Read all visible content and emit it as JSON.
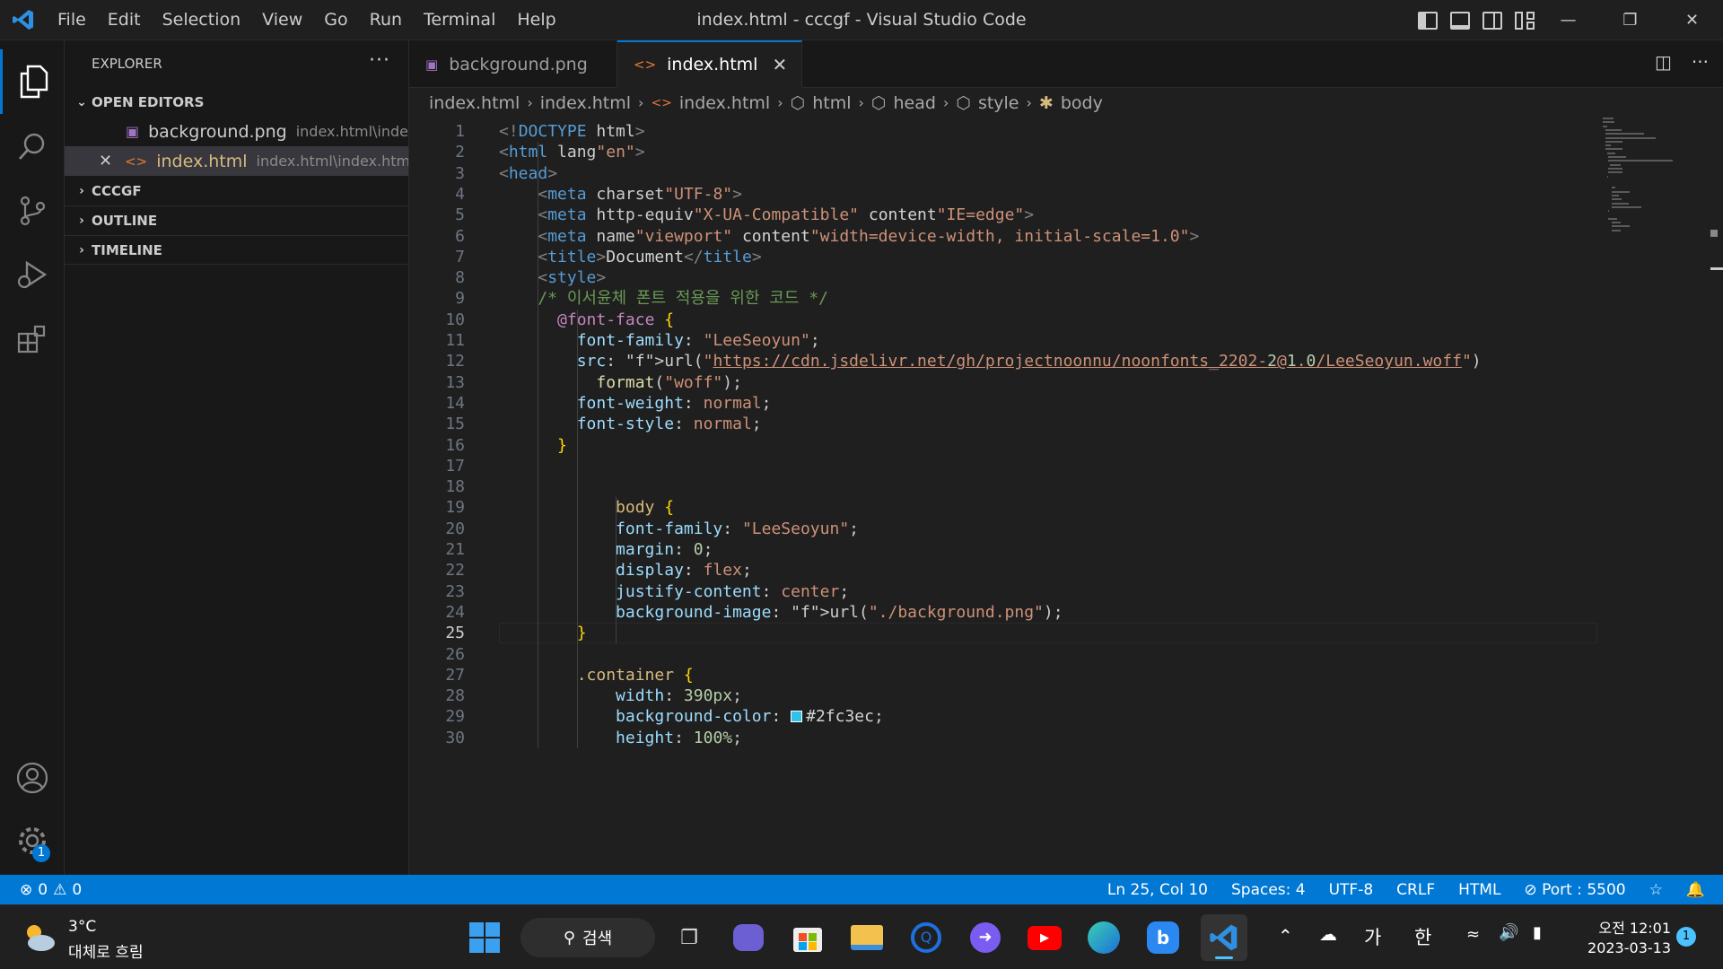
{
  "window": {
    "title": "index.html - cccgf - Visual Studio Code"
  },
  "menu": [
    "File",
    "Edit",
    "Selection",
    "View",
    "Go",
    "Run",
    "Terminal",
    "Help"
  ],
  "sidebar": {
    "title": "EXPLORER",
    "open_editors_label": "OPEN EDITORS",
    "open_editors": [
      {
        "name": "background.png",
        "path": "index.html\\inde..."
      },
      {
        "name": "index.html",
        "path": "index.html\\index.html"
      }
    ],
    "sections": [
      "CCCGF",
      "OUTLINE",
      "TIMELINE"
    ]
  },
  "tabs": [
    {
      "label": "background.png",
      "active": false
    },
    {
      "label": "index.html",
      "active": true
    }
  ],
  "breadcrumb": [
    "index.html",
    "index.html",
    "index.html",
    "html",
    "head",
    "style",
    "body"
  ],
  "editor": {
    "current_line": 25,
    "lines": [
      "<!DOCTYPE html>",
      "<html lang=\"en\">",
      "<head>",
      "    <meta charset=\"UTF-8\">",
      "    <meta http-equiv=\"X-UA-Compatible\" content=\"IE=edge\">",
      "    <meta name=\"viewport\" content=\"width=device-width, initial-scale=1.0\">",
      "    <title>Document</title>",
      "    <style>",
      "    /* 이서윤체 폰트 적용을 위한 코드 */",
      "      @font-face {",
      "        font-family: \"LeeSeoyun\";",
      "        src: url(\"https://cdn.jsdelivr.net/gh/projectnoonnu/noonfonts_2202-2@1.0/LeeSeoyun.woff\")",
      "          format(\"woff\");",
      "        font-weight: normal;",
      "        font-style: normal;",
      "      }",
      "",
      "",
      "            body {",
      "            font-family: \"LeeSeoyun\";",
      "            margin: 0;",
      "            display: flex;",
      "            justify-content: center;",
      "            background-image: url(\"./background.png\");",
      "        }",
      "",
      "        .container {",
      "            width: 390px;",
      "            background-color: #2fc3ec;",
      "            height: 100%;"
    ],
    "swatch_color": "#2fc3ec"
  },
  "status": {
    "errors": "0",
    "warnings": "0",
    "position": "Ln 25, Col 10",
    "spaces": "Spaces: 4",
    "encoding": "UTF-8",
    "eol": "CRLF",
    "language": "HTML",
    "port": "Port : 5500",
    "accent": "#0078d4"
  },
  "taskbar": {
    "weather_temp": "3°C",
    "weather_desc": "대체로 흐림",
    "search_label": "검색",
    "ime1": "가",
    "ime2": "한",
    "time": "오전 12:01",
    "date": "2023-03-13",
    "notif_count": "1",
    "settings_badge": "1"
  }
}
